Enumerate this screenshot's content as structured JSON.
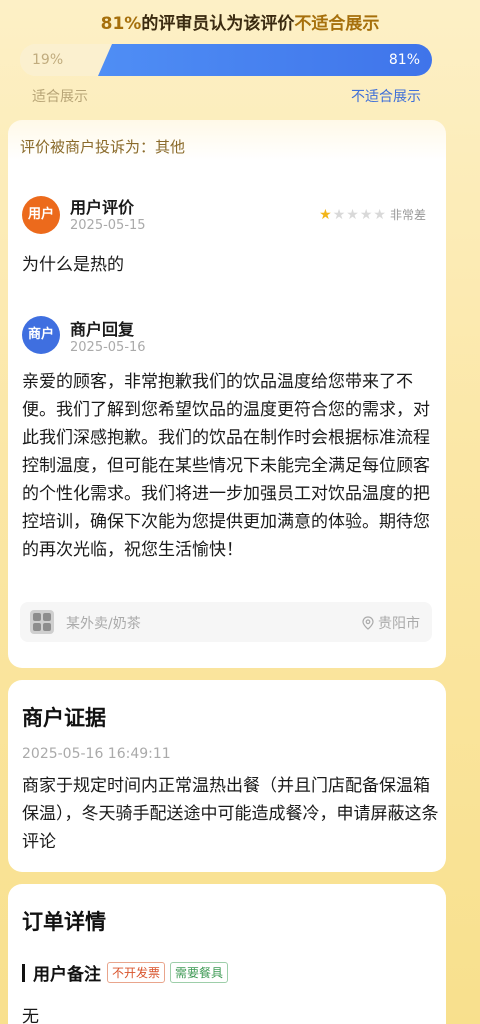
{
  "header": {
    "pct": "81%",
    "mid": "的评审员认为该评价",
    "verdict": "不适合展示"
  },
  "vote_bar": {
    "suitable_pct": "19%",
    "unsuitable_pct": "81%",
    "suitable_fraction": 0.19,
    "unsuitable_fraction": 0.81,
    "suitable_label": "适合展示",
    "unsuitable_label": "不适合展示"
  },
  "review_card": {
    "complaint": "评价被商户投诉为：其他",
    "user": {
      "avatar_text": "用户",
      "name": "用户评价",
      "date": "2025-05-15",
      "rating": 1,
      "max_rating": 5,
      "rating_text": "非常差",
      "text": "为什么是热的"
    },
    "merchant": {
      "avatar_text": "商户",
      "name": "商户回复",
      "date": "2025-05-16",
      "text": "亲爱的顾客，非常抱歉我们的饮品温度给您带来了不便。我们了解到您希望饮品的温度更符合您的需求，对此我们深感抱歉。我们的饮品在制作时会根据标准流程控制温度，但可能在某些情况下未能完全满足每位顾客的个性化需求。我们将进一步加强员工对饮品温度的把控培训，确保下次能为您提供更加满意的体验。期待您的再次光临，祝您生活愉快！"
    },
    "shop": {
      "name": "某外卖/奶茶",
      "location": "贵阳市",
      "icon": "location-pin-icon"
    }
  },
  "evidence": {
    "title": "商户证据",
    "datetime": "2025-05-16 16:49:11",
    "text": "商家于规定时间内正常温热出餐（并且门店配备保温箱保温），冬天骑手配送途中可能造成餐冷，申请屏蔽这条评论"
  },
  "order": {
    "title": "订单详情",
    "note_label": "用户备注",
    "tags": [
      "不开发票",
      "需要餐具"
    ],
    "note_value": "无"
  },
  "colors": {
    "accent_blue": "#3f74ea",
    "highlight_gold": "#a6700c",
    "star_active": "#f2b51a"
  }
}
